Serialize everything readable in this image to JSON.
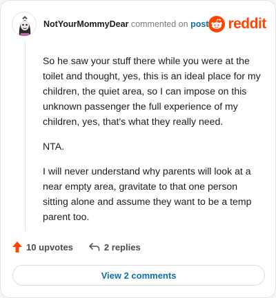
{
  "header": {
    "username": "NotYourMommyDear",
    "verb": "commented on",
    "post_link": "post",
    "brand": "reddit"
  },
  "comment": {
    "paragraphs": [
      "So he saw your stuff there while you were at the toilet and thought, yes, this is an ideal place for my children, the quiet area, so I can impose on this unknown passenger the full experience of my children, yes, that's what they really need.",
      "NTA.",
      "I will never understand why parents will look at a near empty area, gravitate to that one person sitting alone and assume they want to be a temp parent too."
    ]
  },
  "actions": {
    "upvotes": "10 upvotes",
    "replies": "2 replies"
  },
  "footer": {
    "view_comments": "View 2 comments"
  },
  "colors": {
    "brand": "#ff4500",
    "link": "#0f6fa8"
  }
}
